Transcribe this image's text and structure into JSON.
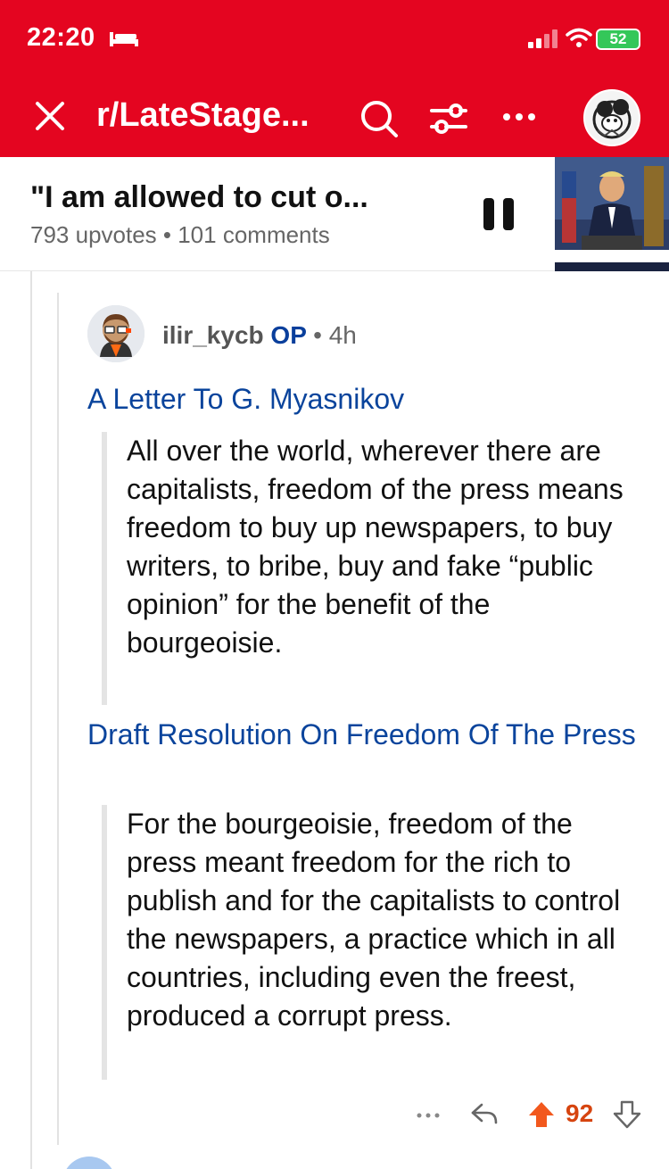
{
  "status_bar": {
    "time": "22:20",
    "battery": "52"
  },
  "header": {
    "subreddit": "r/LateStage...",
    "accent_color": "#e40520"
  },
  "post": {
    "title": "\"I am allowed to cut o...",
    "meta": "793 upvotes • 101 comments"
  },
  "comment": {
    "author": "ilir_kycb",
    "op_badge": "OP",
    "age": "• 4h",
    "link_1": "A Letter To G. Myasnikov",
    "quote_1": "All over the world, wherever there are capitalists, freedom of the press means freedom to buy up newspapers, to buy writers, to bribe, buy and fake “public opinion” for the benefit of the bourgeoisie.",
    "link_2": "Draft Resolution On Freedom Of The Press",
    "quote_2": "For the bourgeoisie, freedom of the press meant freedom for the rich to publish and for the capitalists to control the newspapers, a practice which in all countries, including even the freest, produced a corrupt press.",
    "score": "92",
    "score_color": "#d6440f"
  },
  "icons": [
    "bed-icon",
    "signal-icon",
    "wifi-icon",
    "battery-icon",
    "close-icon",
    "search-icon",
    "filter-icon",
    "more-icon",
    "avatar",
    "pause-icon",
    "reply-icon",
    "upvote-icon",
    "downvote-icon"
  ]
}
